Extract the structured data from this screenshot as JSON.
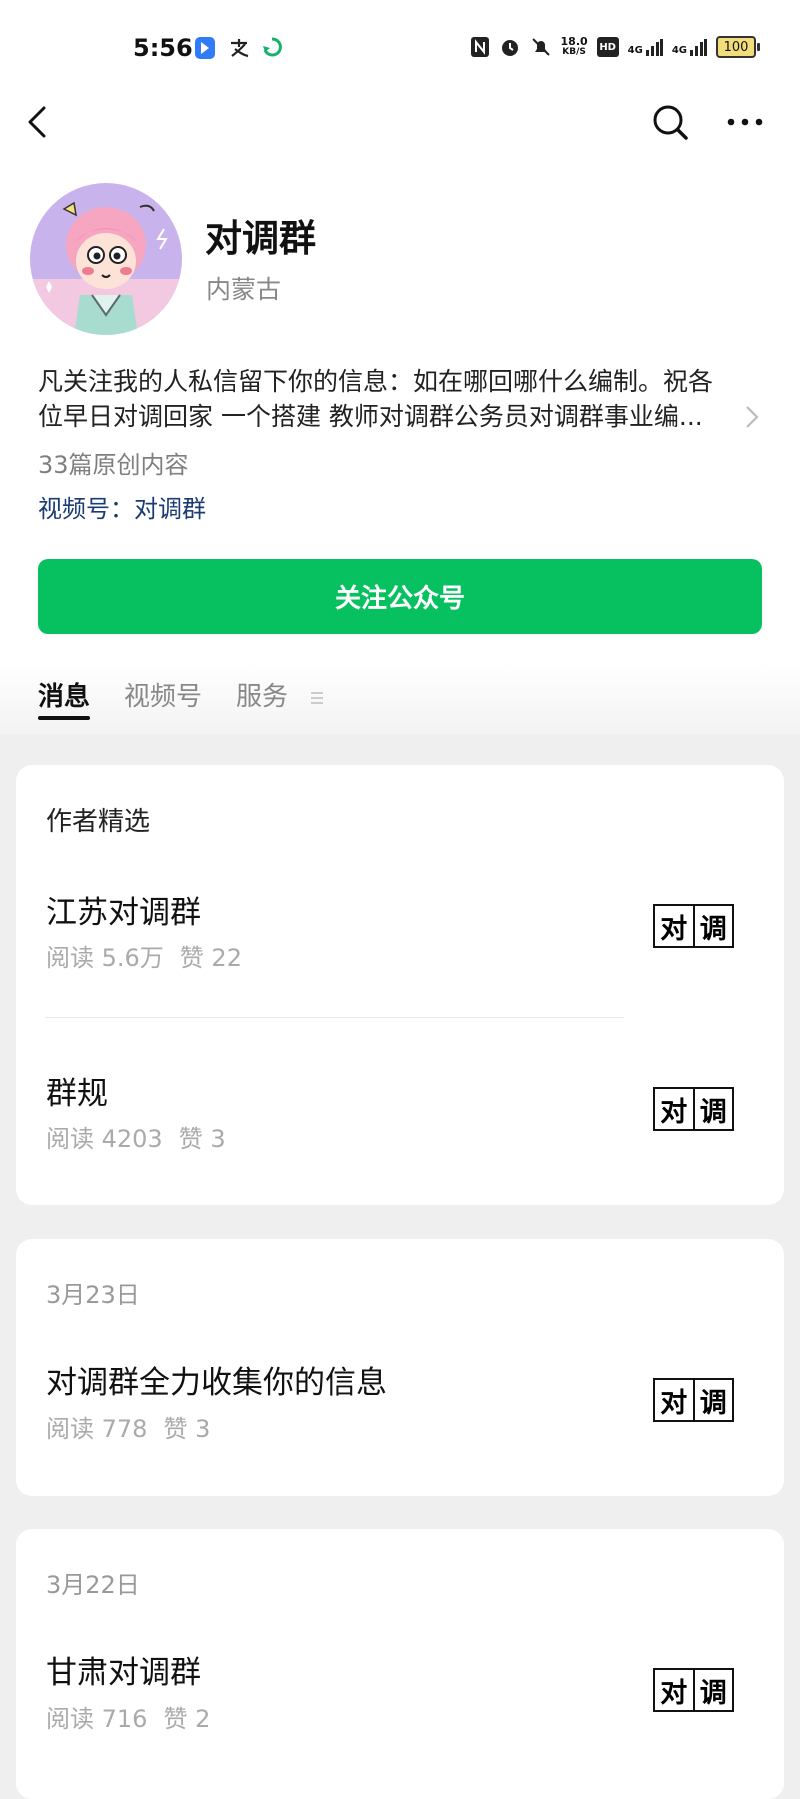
{
  "status_bar": {
    "time": "5:56",
    "net_speed_value": "18.0",
    "net_speed_unit": "KB/S",
    "hd_label": "HD",
    "signal1_label": "4G",
    "signal2_label": "4G",
    "battery": "100"
  },
  "nav": {
    "back_icon": "back-chevron",
    "search_icon": "search",
    "more_icon": "more-dots"
  },
  "profile": {
    "name": "对调群",
    "region": "内蒙古",
    "description_line1": "凡关注我的人私信留下你的信息：如在哪回哪什么编制。祝各",
    "description_line2": "位早日对调回家 一个搭建 教师对调群公务员对调群事业编...",
    "article_count": "33篇原创内容",
    "video_channel": "视频号：对调群"
  },
  "follow_button": "关注公众号",
  "tabs": [
    "消息",
    "视频号",
    "服务"
  ],
  "active_tab": "消息",
  "featured": {
    "title": "作者精选",
    "articles": [
      {
        "title": "江苏对调群",
        "reads": "阅读 5.6万",
        "likes": "赞 22",
        "thumb": [
          "对",
          "调"
        ]
      },
      {
        "title": "群规",
        "reads": "阅读 4203",
        "likes": "赞 3",
        "thumb": [
          "对",
          "调"
        ]
      }
    ]
  },
  "posts": [
    {
      "date": "3月23日",
      "title": "对调群全力收集你的信息",
      "reads": "阅读 778",
      "likes": "赞 3",
      "thumb": [
        "对",
        "调"
      ]
    },
    {
      "date": "3月22日",
      "title": "甘肃对调群",
      "reads": "阅读 716",
      "likes": "赞 2",
      "thumb": [
        "对",
        "调"
      ]
    }
  ],
  "colors": {
    "primary_green": "#07c160",
    "link_blue": "#1b3b73",
    "background": "#efefef"
  }
}
